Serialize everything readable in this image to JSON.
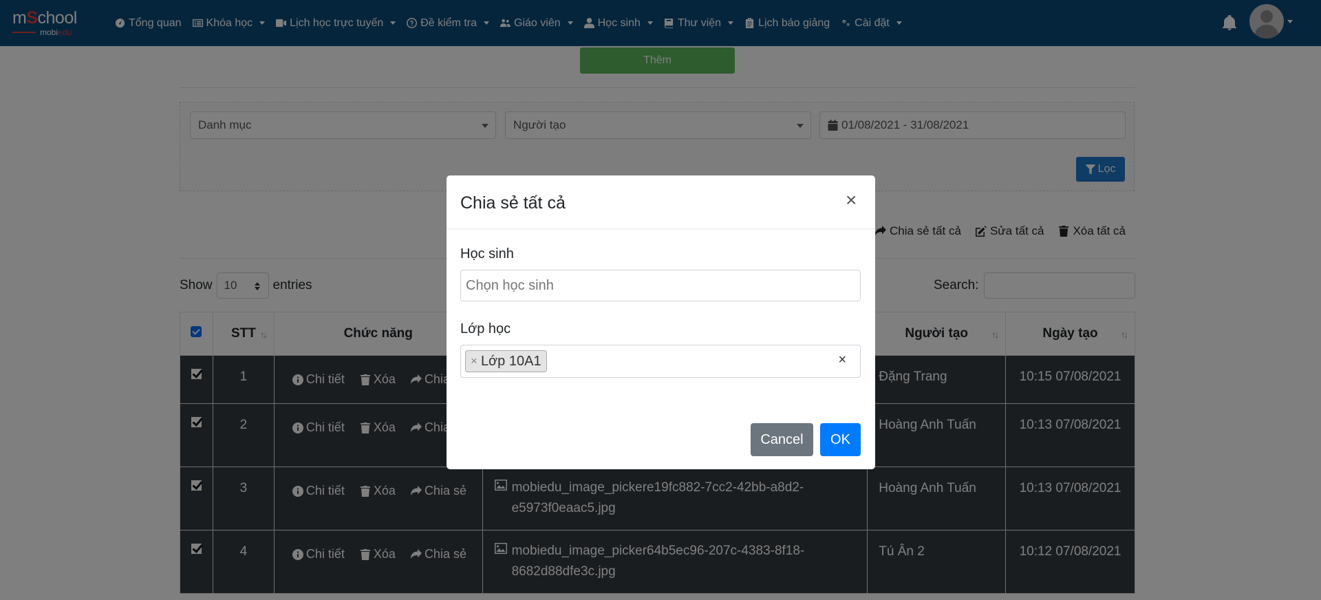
{
  "brand": {
    "logo_main_a": "m",
    "logo_main_s": "S",
    "logo_main_b": "chool",
    "logo_sub_a": "mobi",
    "logo_sub_b": "edu"
  },
  "nav": {
    "items": [
      {
        "label": "Tổng quan",
        "icon": "dashboard-icon",
        "dropdown": false
      },
      {
        "label": "Khóa học",
        "icon": "list-icon",
        "dropdown": true
      },
      {
        "label": "Lịch học trực tuyến",
        "icon": "video-icon",
        "dropdown": true
      },
      {
        "label": "Đề kiểm tra",
        "icon": "question-circle-icon",
        "dropdown": true
      },
      {
        "label": "Giáo viên",
        "icon": "users-icon",
        "dropdown": true
      },
      {
        "label": "Học sinh",
        "icon": "user-icon",
        "dropdown": true
      },
      {
        "label": "Thư viện",
        "icon": "book-icon",
        "dropdown": true
      },
      {
        "label": "Lịch báo giảng",
        "icon": "clipboard-icon",
        "dropdown": false
      },
      {
        "label": "Cài đặt",
        "icon": "cogs-icon",
        "dropdown": true
      }
    ]
  },
  "toolbar": {
    "add_label": "Thêm"
  },
  "filters": {
    "category_placeholder": "Danh mục",
    "creator_placeholder": "Người tạo",
    "date_range": "01/08/2021 - 31/08/2021",
    "filter_label": "Lọc"
  },
  "bulk": {
    "share_all": "Chia sẻ tất cả",
    "edit_all": "Sửa tất cả",
    "delete_all": "Xóa tất cả"
  },
  "datatable": {
    "show_label": "Show",
    "entries_label": "entries",
    "page_length": "10",
    "search_label": "Search:",
    "columns": {
      "stt": "STT",
      "actions": "Chức năng",
      "creator": "Người tạo",
      "created": "Ngày tạo"
    },
    "action_labels": {
      "detail": "Chi tiết",
      "delete": "Xóa",
      "share": "Chia sẻ",
      "share_cut": "Chia"
    },
    "rows": [
      {
        "stt": "1",
        "file_line1": "",
        "file_line2": "",
        "creator": "Đặng Trang",
        "created": "10:15 07/08/2021"
      },
      {
        "stt": "2",
        "file_line1": "",
        "file_line2": "",
        "creator": "Hoàng Anh Tuấn",
        "created": "10:13 07/08/2021"
      },
      {
        "stt": "3",
        "file_line1": "mobiedu_image_pickere19fc882-7cc2-42bb-a8d2-",
        "file_line2": "e5973f0eaac5.jpg",
        "creator": "Hoàng Anh Tuấn",
        "created": "10:13 07/08/2021"
      },
      {
        "stt": "4",
        "file_line1": "mobiedu_image_picker64b5ec96-207c-4383-8f18-",
        "file_line2": "8682d88dfe3c.jpg",
        "creator": "Tú Ân 2",
        "created": "10:12 07/08/2021"
      }
    ]
  },
  "modal": {
    "title": "Chia sẻ tất cả",
    "close": "×",
    "student_label": "Học sinh",
    "student_placeholder": "Chọn học sinh",
    "class_label": "Lớp học",
    "class_tag": "Lớp 10A1",
    "tag_remove": "×",
    "clear": "×",
    "cancel_label": "Cancel",
    "ok_label": "OK"
  }
}
